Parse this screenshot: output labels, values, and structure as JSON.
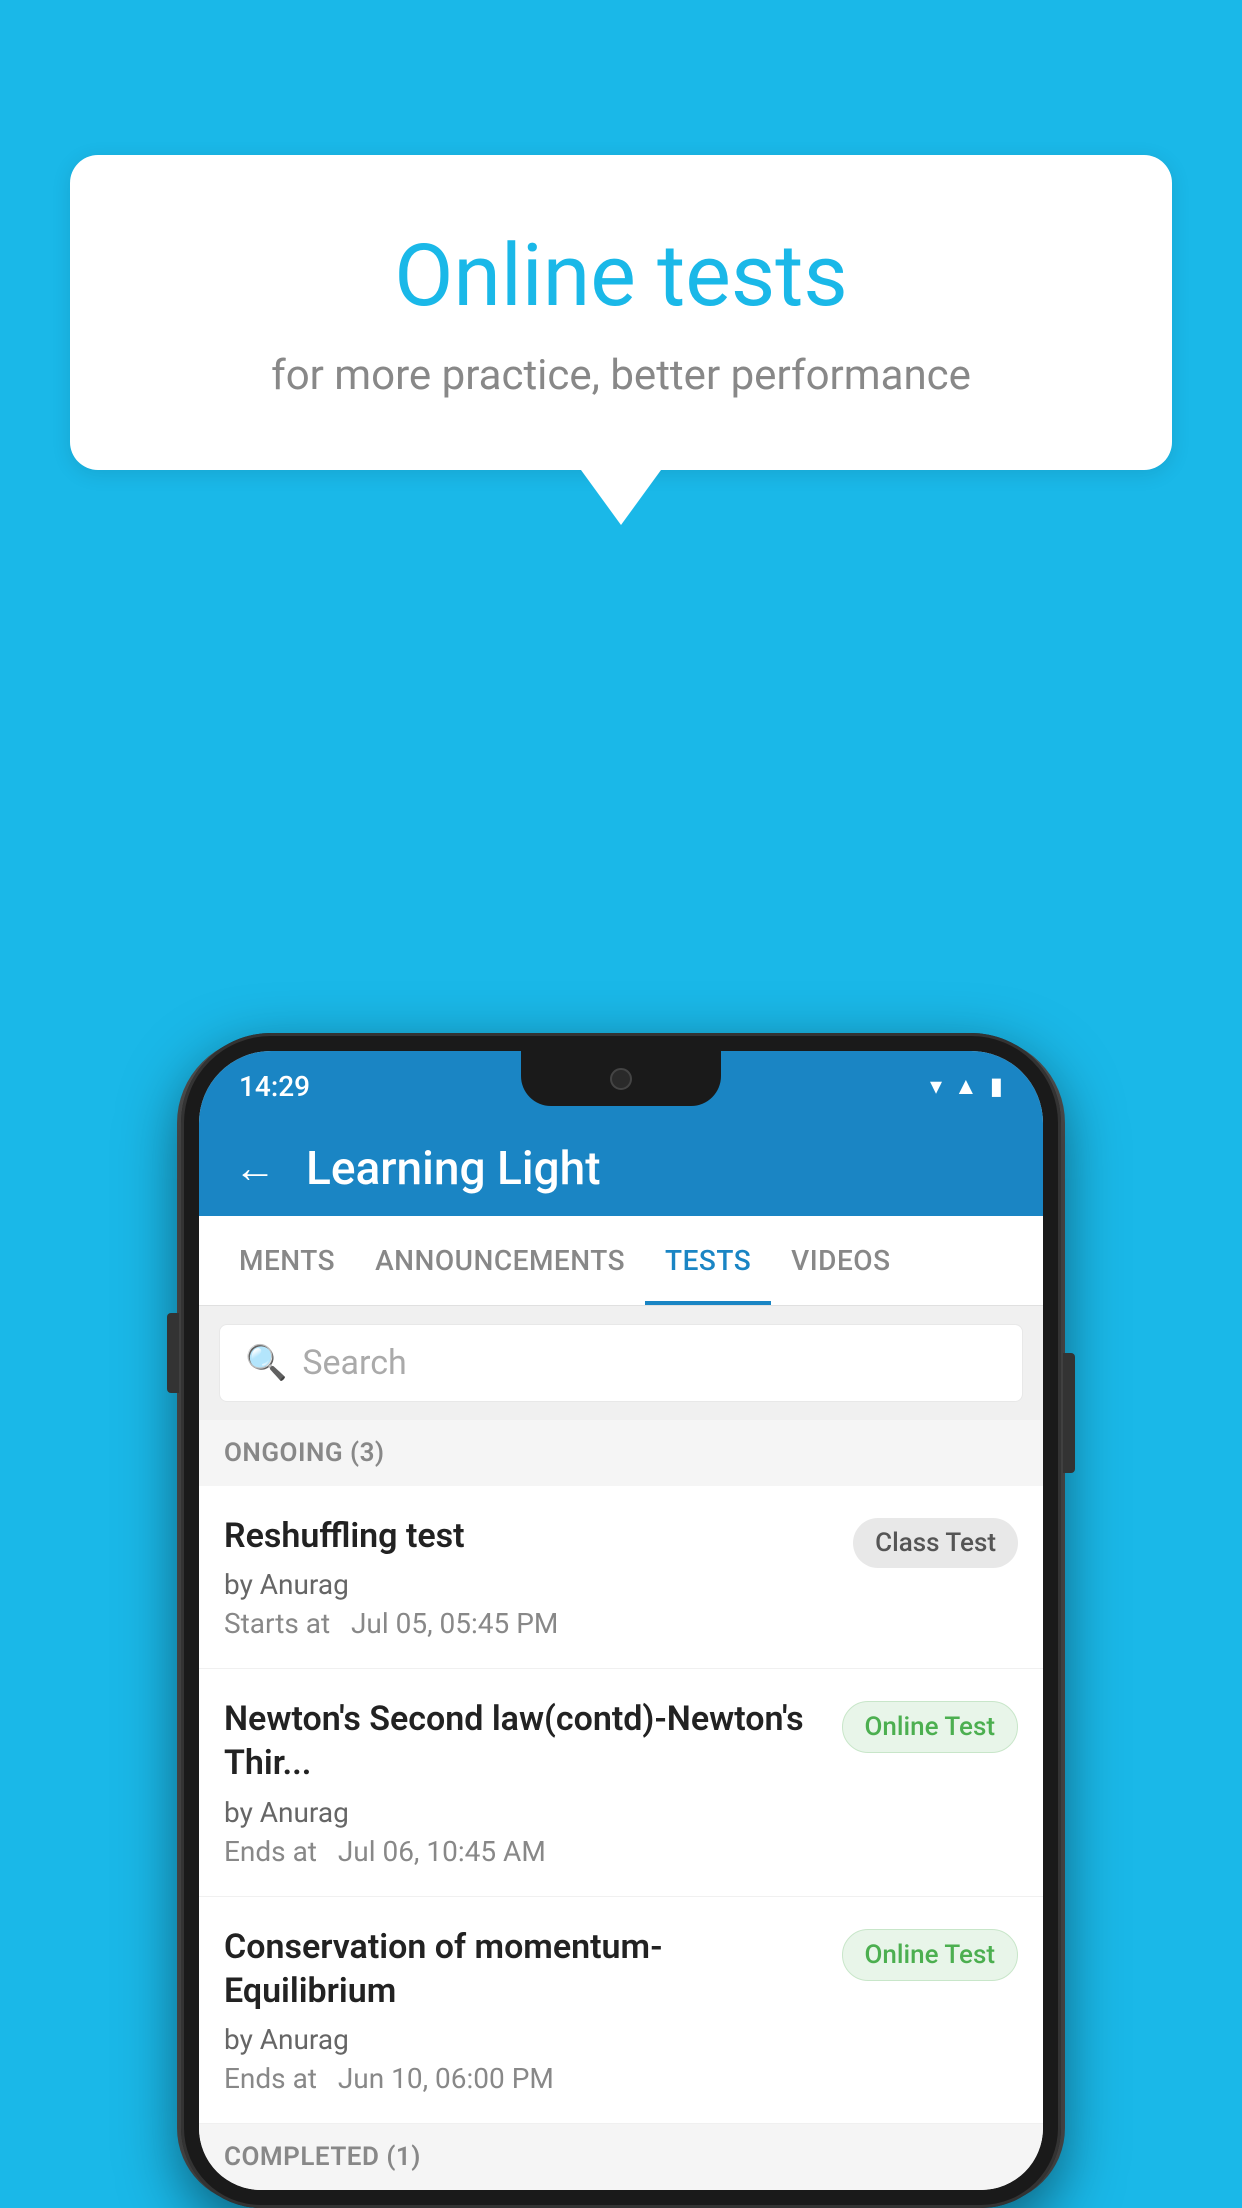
{
  "background_color": "#1ab8e8",
  "bubble": {
    "title": "Online tests",
    "subtitle": "for more practice, better performance"
  },
  "status_bar": {
    "time": "14:29",
    "icons": [
      "wifi",
      "signal",
      "battery"
    ]
  },
  "header": {
    "title": "Learning Light",
    "back_label": "←"
  },
  "tabs": [
    {
      "label": "MENTS",
      "active": false
    },
    {
      "label": "ANNOUNCEMENTS",
      "active": false
    },
    {
      "label": "TESTS",
      "active": true
    },
    {
      "label": "VIDEOS",
      "active": false
    }
  ],
  "search": {
    "placeholder": "Search"
  },
  "sections": [
    {
      "label": "ONGOING (3)",
      "items": [
        {
          "name": "Reshuffling test",
          "author": "by Anurag",
          "time_label": "Starts at",
          "time_value": "Jul 05, 05:45 PM",
          "badge": "Class Test",
          "badge_type": "class"
        },
        {
          "name": "Newton's Second law(contd)-Newton's Thir...",
          "author": "by Anurag",
          "time_label": "Ends at",
          "time_value": "Jul 06, 10:45 AM",
          "badge": "Online Test",
          "badge_type": "online"
        },
        {
          "name": "Conservation of momentum-Equilibrium",
          "author": "by Anurag",
          "time_label": "Ends at",
          "time_value": "Jun 10, 06:00 PM",
          "badge": "Online Test",
          "badge_type": "online"
        }
      ]
    }
  ],
  "completed_label": "COMPLETED (1)"
}
